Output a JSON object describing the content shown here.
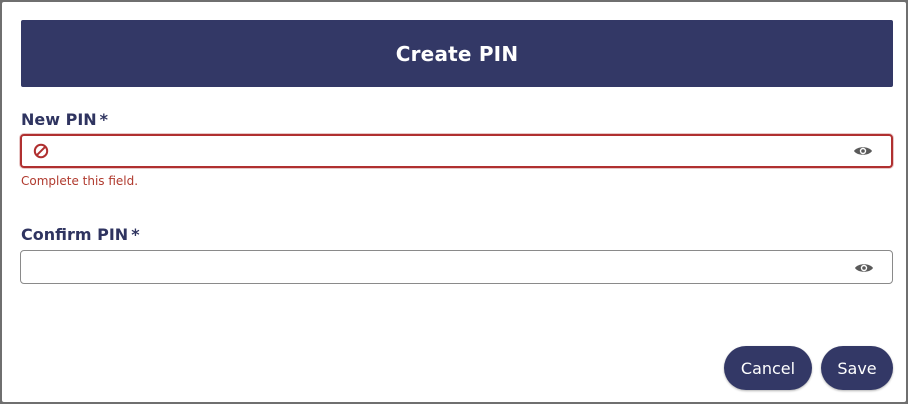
{
  "dialog": {
    "title": "Create PIN"
  },
  "new_pin": {
    "label": "New PIN",
    "required_mark": "*",
    "value": "",
    "error": "Complete this field."
  },
  "confirm_pin": {
    "label": "Confirm PIN",
    "required_mark": "*",
    "value": ""
  },
  "actions": {
    "cancel_label": "Cancel",
    "save_label": "Save"
  },
  "colors": {
    "brand": "#333866",
    "error": "#b03030"
  },
  "icons": {
    "error": "prohibited-icon",
    "toggle_visibility": "eye-icon"
  }
}
